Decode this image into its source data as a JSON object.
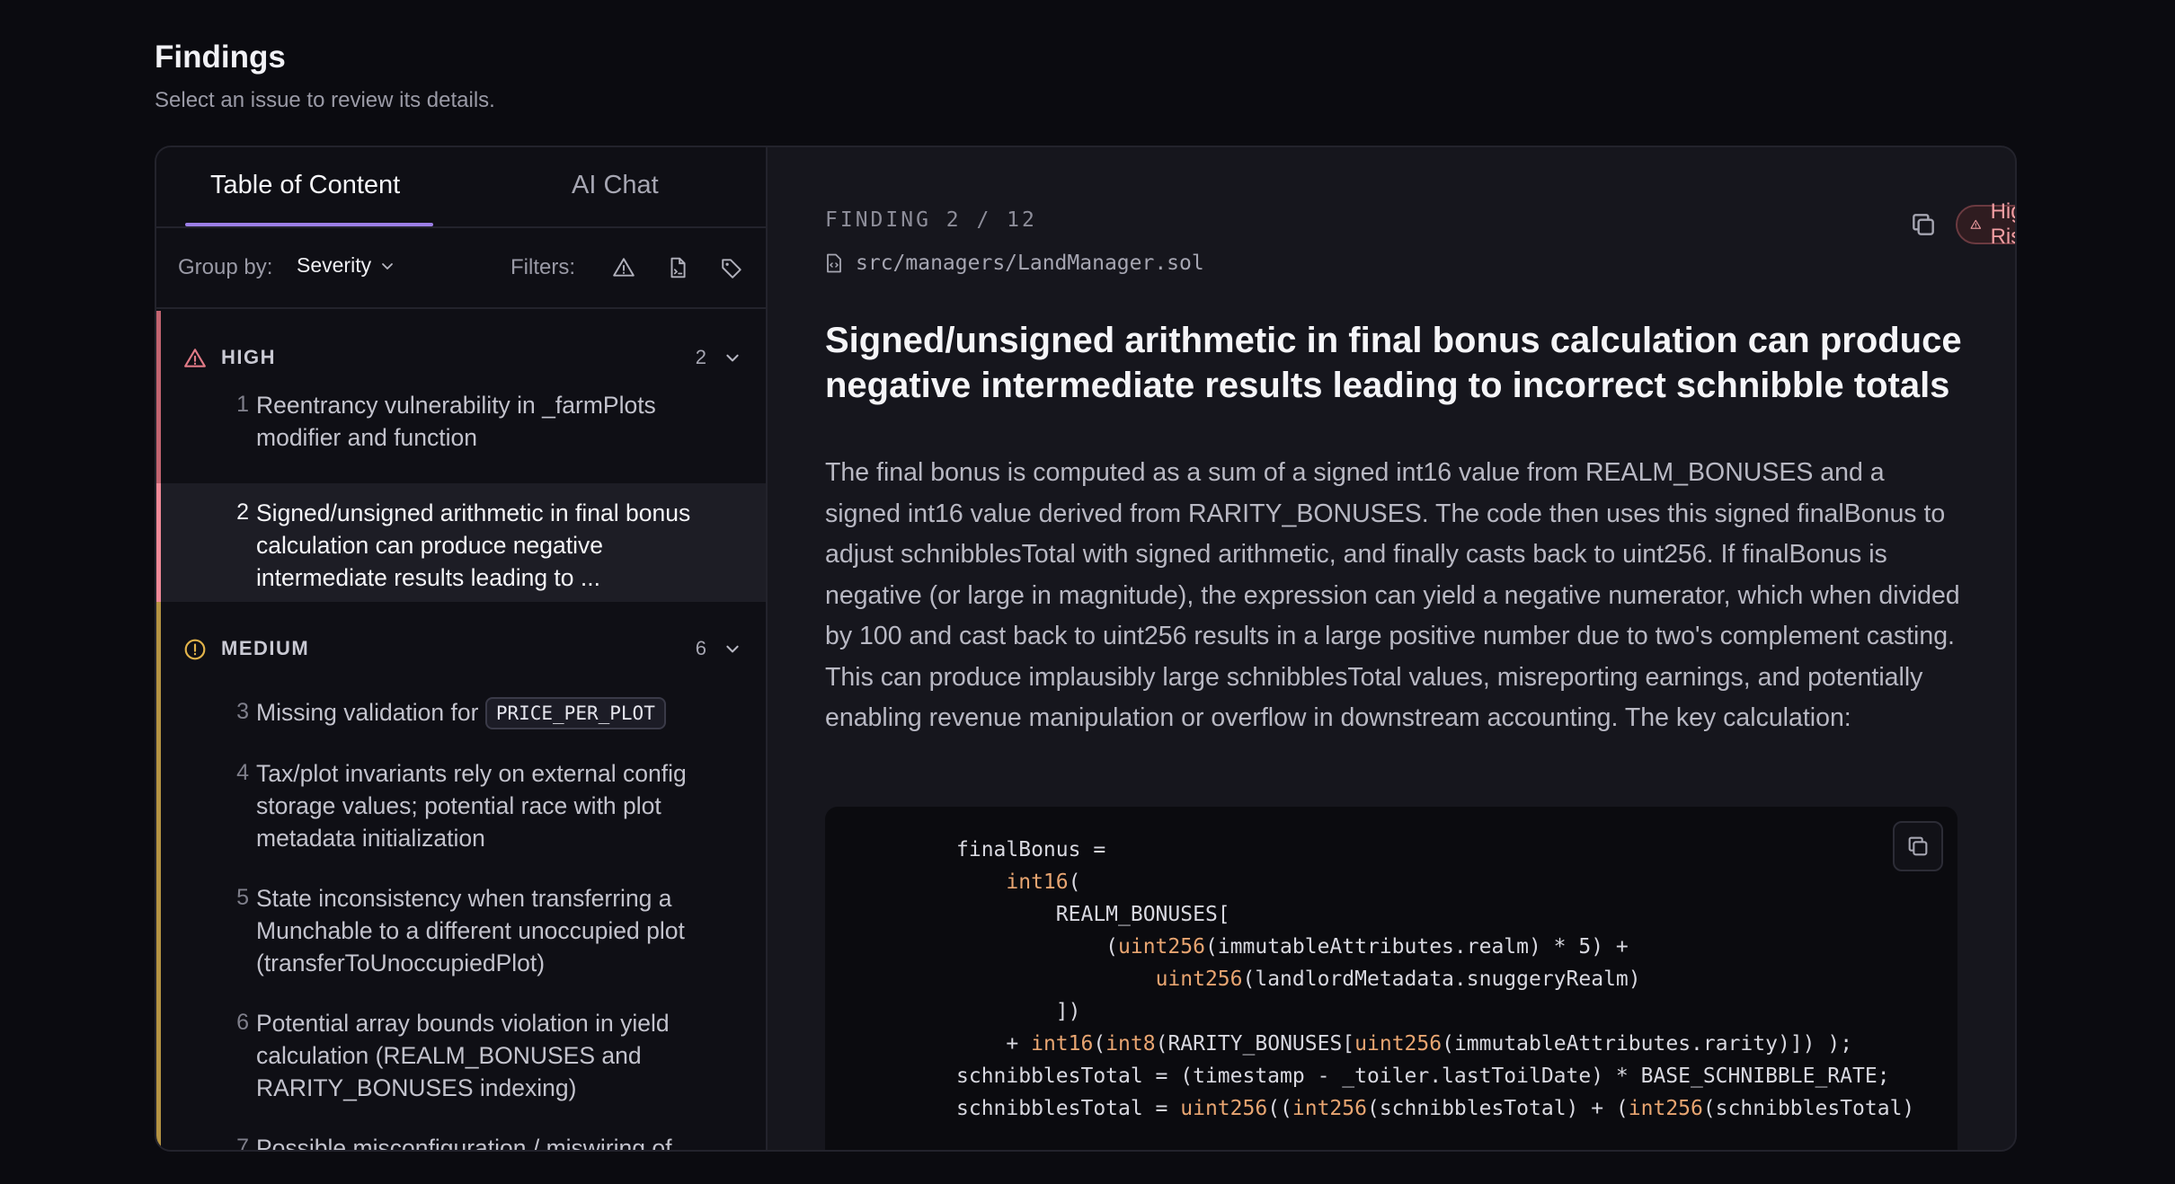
{
  "page": {
    "title": "Findings",
    "subtitle": "Select an issue to review its details."
  },
  "tabs": [
    {
      "label": "Table of Content",
      "active": true
    },
    {
      "label": "AI Chat",
      "active": false
    }
  ],
  "toolbar": {
    "group_by_label": "Group by:",
    "group_by_value": "Severity",
    "filters_label": "Filters:",
    "filter_icons": [
      "warning-triangle-icon",
      "file-icon",
      "tag-icon"
    ]
  },
  "groups": [
    {
      "name": "HIGH",
      "count": "2",
      "color": "#e07a86",
      "icon": "warning-triangle-icon",
      "items": [
        {
          "num": "1",
          "text": "Reentrancy vulnerability in _farmPlots modifier and function"
        },
        {
          "num": "2",
          "text": "Signed/unsigned arithmetic in final bonus calculation can produce negative intermediate results leading to ...",
          "selected": true
        }
      ]
    },
    {
      "name": "MEDIUM",
      "count": "6",
      "color": "#e2b34a",
      "icon": "alert-circle-icon",
      "items": [
        {
          "num": "3",
          "text": "Missing validation for",
          "chip": "PRICE_PER_PLOT"
        },
        {
          "num": "4",
          "text": "Tax/plot invariants rely on external config storage values; potential race with plot metadata initialization"
        },
        {
          "num": "5",
          "text": "State inconsistency when transferring a Munchable to a different unoccupied plot (transferToUnoccupiedPlot)"
        },
        {
          "num": "6",
          "text": "Potential array bounds violation in yield calculation (REALM_BONUSES and RARITY_BONUSES indexing)"
        },
        {
          "num": "7",
          "text": "Possible misconfiguration / miswiring of"
        }
      ]
    }
  ],
  "finding": {
    "counter": "FINDING 2 / 12",
    "risk_label": "High Risk",
    "risk_color": "#f29ea3",
    "file_path": "src/managers/LandManager.sol",
    "title": "Signed/unsigned arithmetic in final bonus calculation can produce negative intermediate results leading to incorrect schnibble totals",
    "description": "The final bonus is computed as a sum of a signed int16 value from REALM_BONUSES and a signed int16 value derived from RARITY_BONUSES. The code then uses this signed finalBonus to adjust schnibblesTotal with signed arithmetic, and finally casts back to uint256. If finalBonus is negative (or large in magnitude), the expression can yield a negative numerator, which when divided by 100 and cast back to uint256 results in a large positive number due to two's complement casting. This can produce implausibly large schnibblesTotal values, misreporting earnings, and potentially enabling revenue manipulation or overflow in downstream accounting. The key calculation:",
    "code_lines": [
      [
        {
          "t": "finalBonus ="
        }
      ],
      [
        {
          "t": "    "
        },
        {
          "t": "int16",
          "k": true
        },
        {
          "t": "("
        }
      ],
      [
        {
          "t": "        REALM_BONUSES["
        }
      ],
      [
        {
          "t": "            ("
        },
        {
          "t": "uint256",
          "k": true
        },
        {
          "t": "(immutableAttributes.realm) * 5) +"
        }
      ],
      [
        {
          "t": "                "
        },
        {
          "t": "uint256",
          "k": true
        },
        {
          "t": "(landlordMetadata.snuggeryRealm)"
        }
      ],
      [
        {
          "t": "        ])"
        }
      ],
      [
        {
          "t": "    + "
        },
        {
          "t": "int16",
          "k": true
        },
        {
          "t": "("
        },
        {
          "t": "int8",
          "k": true
        },
        {
          "t": "(RARITY_BONUSES["
        },
        {
          "t": "uint256",
          "k": true
        },
        {
          "t": "(immutableAttributes.rarity)]) );"
        }
      ],
      [
        {
          "t": "schnibblesTotal = (timestamp - _toiler.lastToilDate) * BASE_SCHNIBBLE_RATE;"
        }
      ],
      [
        {
          "t": "schnibblesTotal = "
        },
        {
          "t": "uint256",
          "k": true
        },
        {
          "t": "(("
        },
        {
          "t": "int256",
          "k": true
        },
        {
          "t": "(schnibblesTotal) + ("
        },
        {
          "t": "int256",
          "k": true
        },
        {
          "t": "(schnibblesTotal)"
        }
      ]
    ]
  }
}
